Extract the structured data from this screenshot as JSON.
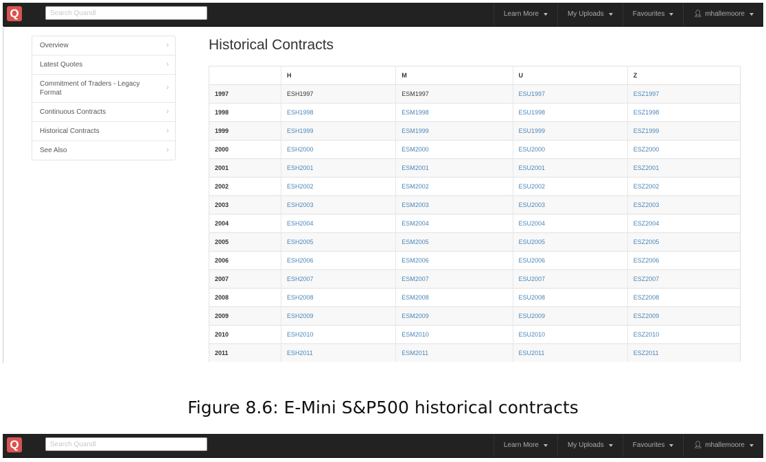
{
  "navbar": {
    "logo": "Q",
    "search_placeholder": "Search Quandl",
    "links": [
      "Learn More",
      "My Uploads",
      "Favourites"
    ],
    "user": "mhallemoore"
  },
  "sidebar": {
    "items": [
      "Overview",
      "Latest Quotes",
      "Commitment of Traders - Legacy Format",
      "Continuous Contracts",
      "Historical Contracts",
      "See Also"
    ]
  },
  "page_title": "Historical Contracts",
  "table": {
    "headers": [
      "",
      "H",
      "M",
      "U",
      "Z"
    ],
    "rows": [
      {
        "year": "1997",
        "cells": [
          "ESH1997",
          "ESM1997",
          "ESU1997",
          "ESZ1997"
        ],
        "linked": [
          false,
          false,
          true,
          true
        ]
      },
      {
        "year": "1998",
        "cells": [
          "ESH1998",
          "ESM1998",
          "ESU1998",
          "ESZ1998"
        ],
        "linked": [
          true,
          true,
          true,
          true
        ]
      },
      {
        "year": "1999",
        "cells": [
          "ESH1999",
          "ESM1999",
          "ESU1999",
          "ESZ1999"
        ],
        "linked": [
          true,
          true,
          true,
          true
        ]
      },
      {
        "year": "2000",
        "cells": [
          "ESH2000",
          "ESM2000",
          "ESU2000",
          "ESZ2000"
        ],
        "linked": [
          true,
          true,
          true,
          true
        ]
      },
      {
        "year": "2001",
        "cells": [
          "ESH2001",
          "ESM2001",
          "ESU2001",
          "ESZ2001"
        ],
        "linked": [
          true,
          true,
          true,
          true
        ]
      },
      {
        "year": "2002",
        "cells": [
          "ESH2002",
          "ESM2002",
          "ESU2002",
          "ESZ2002"
        ],
        "linked": [
          true,
          true,
          true,
          true
        ]
      },
      {
        "year": "2003",
        "cells": [
          "ESH2003",
          "ESM2003",
          "ESU2003",
          "ESZ2003"
        ],
        "linked": [
          true,
          true,
          true,
          true
        ]
      },
      {
        "year": "2004",
        "cells": [
          "ESH2004",
          "ESM2004",
          "ESU2004",
          "ESZ2004"
        ],
        "linked": [
          true,
          true,
          true,
          true
        ]
      },
      {
        "year": "2005",
        "cells": [
          "ESH2005",
          "ESM2005",
          "ESU2005",
          "ESZ2005"
        ],
        "linked": [
          true,
          true,
          true,
          true
        ]
      },
      {
        "year": "2006",
        "cells": [
          "ESH2006",
          "ESM2006",
          "ESU2006",
          "ESZ2006"
        ],
        "linked": [
          true,
          true,
          true,
          true
        ]
      },
      {
        "year": "2007",
        "cells": [
          "ESH2007",
          "ESM2007",
          "ESU2007",
          "ESZ2007"
        ],
        "linked": [
          true,
          true,
          true,
          true
        ]
      },
      {
        "year": "2008",
        "cells": [
          "ESH2008",
          "ESM2008",
          "ESU2008",
          "ESZ2008"
        ],
        "linked": [
          true,
          true,
          true,
          true
        ]
      },
      {
        "year": "2009",
        "cells": [
          "ESH2009",
          "ESM2009",
          "ESU2009",
          "ESZ2009"
        ],
        "linked": [
          true,
          true,
          true,
          true
        ]
      },
      {
        "year": "2010",
        "cells": [
          "ESH2010",
          "ESM2010",
          "ESU2010",
          "ESZ2010"
        ],
        "linked": [
          true,
          true,
          true,
          true
        ]
      },
      {
        "year": "2011",
        "cells": [
          "ESH2011",
          "ESM2011",
          "ESU2011",
          "ESZ2011"
        ],
        "linked": [
          true,
          true,
          true,
          true
        ]
      }
    ]
  },
  "caption": "Figure 8.6: E-Mini S&P500 historical contracts",
  "colors": {
    "navbar": "#222222",
    "logo": "#d9534f",
    "link": "#4a86b8"
  },
  "icons": {
    "chevron": "chevron-right-icon",
    "user": "user-icon",
    "dropdown": "caret-down-icon"
  }
}
